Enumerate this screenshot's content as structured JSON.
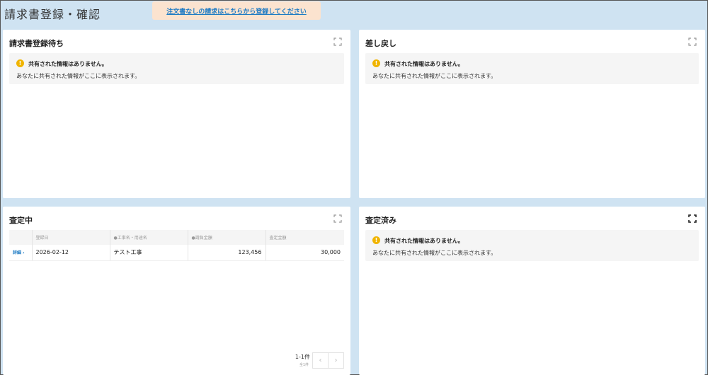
{
  "page": {
    "title": "請求書登録・確認",
    "banner_link": "注文書なしの請求はこちらから登録してください"
  },
  "panels": {
    "pending": {
      "title": "請求書登録待ち",
      "notice_title": "共有された情報はありません。",
      "notice_desc": "あなたに共有された情報がここに表示されます。"
    },
    "returned": {
      "title": "差し戻し",
      "notice_title": "共有された情報はありません。",
      "notice_desc": "あなたに共有された情報がここに表示されます。"
    },
    "assessing": {
      "title": "査定中",
      "columns": [
        "",
        "登録日",
        "●工事名・用途名",
        "●請負金額",
        "査定金額"
      ],
      "rows": [
        {
          "link": "詳細 ›",
          "date": "2026-02-12",
          "name": "テスト工事",
          "contract": "123,456",
          "assessed": "30,000"
        }
      ],
      "pager_count": "1-1件",
      "pager_total": "全1件",
      "prev": "‹",
      "next": "›"
    },
    "assessed": {
      "title": "査定済み",
      "notice_title": "共有された情報はありません。",
      "notice_desc": "あなたに共有された情報がここに表示されます。"
    }
  },
  "icons": {
    "expand": "expand-icon",
    "warning": "warning-icon"
  },
  "colors": {
    "background": "#cfe3f2",
    "link": "#1e7bc4",
    "banner": "#fbe3cf",
    "warning": "#f0b400"
  }
}
